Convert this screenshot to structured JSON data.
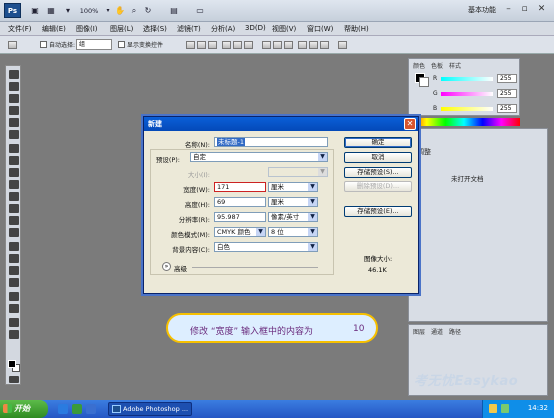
{
  "titlebar": {
    "logo": "Ps",
    "zoom": "100%",
    "workspace": "基本功能",
    "icons": [
      "bridge-icon",
      "minibridge-icon",
      "zoom-icon",
      "hand-icon",
      "rotate-icon",
      "arrange-icon",
      "screen-mode-icon"
    ]
  },
  "menu": [
    "文件(F)",
    "编辑(E)",
    "图像(I)",
    "图层(L)",
    "选择(S)",
    "滤镜(T)",
    "分析(A)",
    "3D(D)",
    "视图(V)",
    "窗口(W)",
    "帮助(H)"
  ],
  "options": {
    "auto_select_label": "自动选择:",
    "auto_select_value": "组",
    "show_transform_label": "显示变换控件"
  },
  "color_panel": {
    "tabs": [
      "颜色",
      "色板",
      "样式"
    ],
    "channels": [
      {
        "label": "R",
        "value": "255"
      },
      {
        "label": "G",
        "value": "255"
      },
      {
        "label": "B",
        "value": "255"
      }
    ]
  },
  "adjust_panel": {
    "title": "调整",
    "message": "未打开文档"
  },
  "layers_panel": {
    "tabs": [
      "图层",
      "通道",
      "路径"
    ]
  },
  "dialog": {
    "title": "新建",
    "name_label": "名称(N):",
    "name_value": "未标题-1",
    "preset_label": "预设(P):",
    "preset_value": "自定",
    "size_label": "大小(I):",
    "width_label": "宽度(W):",
    "width_value": "171",
    "width_unit": "厘米",
    "height_label": "高度(H):",
    "height_value": "69",
    "height_unit": "厘米",
    "resolution_label": "分辨率(R):",
    "resolution_value": "95.987",
    "resolution_unit": "像素/英寸",
    "color_mode_label": "颜色模式(M):",
    "color_mode_value": "CMYK 颜色",
    "color_depth_value": "8 位",
    "background_label": "背景内容(C):",
    "background_value": "白色",
    "advanced_label": "高级",
    "buttons": {
      "ok": "确定",
      "cancel": "取消",
      "save_preset": "存储预设(S)...",
      "delete_preset": "删除预设(D)...",
      "device_central": "存储预设(E)..."
    },
    "image_size_label": "图像大小:",
    "image_size_value": "46.1K"
  },
  "instruction": {
    "text": "修改 “宽度” 输入框中的内容为",
    "value": "10"
  },
  "watermark": "考无忧Easykao",
  "taskbar": {
    "start": "开始",
    "task": "Adobe Photoshop ...",
    "time": "14:32"
  },
  "colors": {
    "dialog_title": "#0a5fd8",
    "balloon_border": "#f6c000",
    "taskbar": "#2556c4",
    "start": "#2e8b22"
  }
}
